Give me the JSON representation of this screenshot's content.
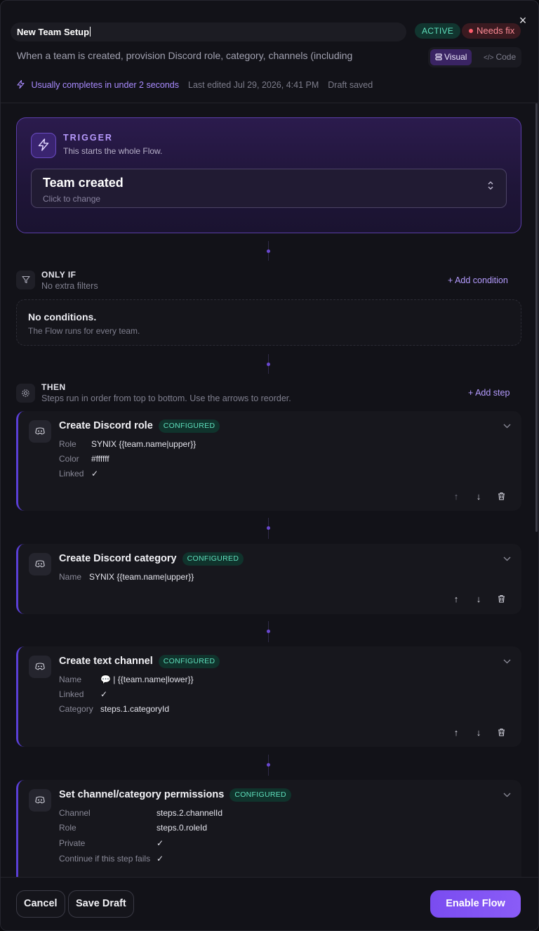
{
  "header": {
    "title_value": "New Team Setup",
    "status_active": "ACTIVE",
    "status_fix": "Needs fix",
    "close_icon": "×",
    "description": "When a team is created, provision Discord role, category, channels (including",
    "mode_visual": "Visual",
    "mode_code": "Code",
    "speed_note": "Usually completes in under 2 seconds",
    "last_edited": "Last edited Jul 29, 2026, 4:41 PM",
    "draft_status": "Draft saved"
  },
  "trigger": {
    "label": "TRIGGER",
    "subtitle": "This starts the whole Flow.",
    "value": "Team created",
    "hint": "Click to change"
  },
  "only_if": {
    "title": "ONLY IF",
    "subtitle": "No extra filters",
    "add_label": "+ Add condition",
    "empty_title": "No conditions.",
    "empty_sub": "The Flow runs for every team."
  },
  "then": {
    "title": "THEN",
    "subtitle": "Steps run in order from top to bottom. Use the arrows to reorder.",
    "add_label": "+ Add step"
  },
  "steps": [
    {
      "title": "Create Discord role",
      "badge": "CONFIGURED",
      "fields": [
        {
          "k": "Role",
          "v": "SYNIX {{team.name|upper}}"
        },
        {
          "k": "Color",
          "v": "#ffffff"
        },
        {
          "k": "Linked",
          "v": "✓"
        }
      ]
    },
    {
      "title": "Create Discord category",
      "badge": "CONFIGURED",
      "fields": [
        {
          "k": "Name",
          "v": "SYNIX {{team.name|upper}}"
        }
      ]
    },
    {
      "title": "Create text channel",
      "badge": "CONFIGURED",
      "fields": [
        {
          "k": "Name",
          "v": "💬 | {{team.name|lower}}"
        },
        {
          "k": "Linked",
          "v": "✓"
        },
        {
          "k": "Category",
          "v": "steps.1.categoryId"
        }
      ]
    },
    {
      "title": "Set channel/category permissions",
      "badge": "CONFIGURED",
      "fields": [
        {
          "k": "Channel",
          "v": "steps.2.channelId"
        },
        {
          "k": "Role",
          "v": "steps.0.roleId"
        },
        {
          "k": "Private",
          "v": "✓"
        },
        {
          "k": "Continue if this step fails",
          "v": "✓"
        }
      ]
    }
  ],
  "icons": {
    "bolt": "⚡",
    "filter": "⛛",
    "gear": "⚙",
    "discord": "◉",
    "chevron_down": "⌄",
    "arrow_up": "↑",
    "arrow_down": "↓",
    "trash": "🗑",
    "updown": "⌃⌄"
  },
  "footer": {
    "cancel": "Cancel",
    "save_draft": "Save Draft",
    "enable": "Enable Flow"
  }
}
